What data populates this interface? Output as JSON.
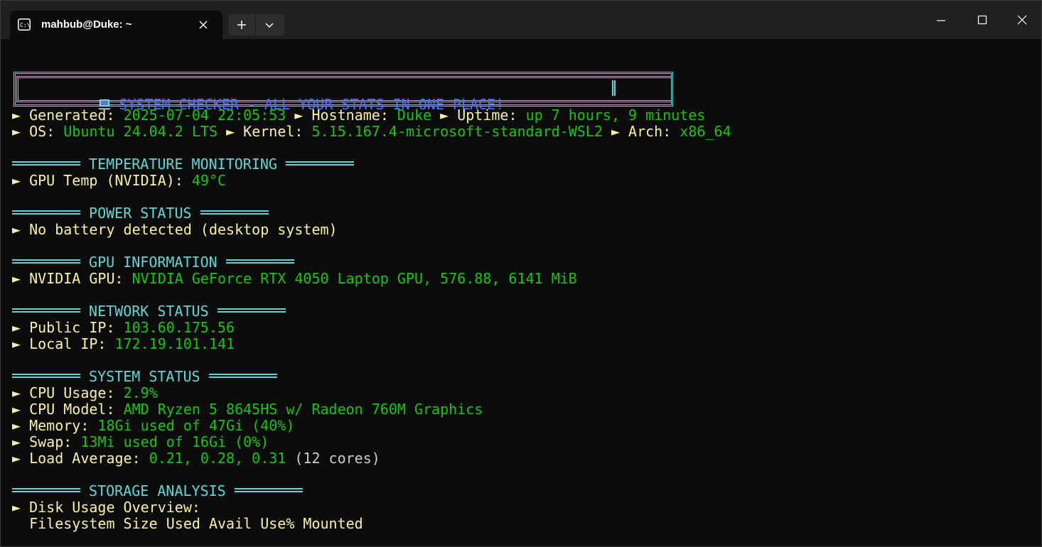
{
  "window": {
    "tab_title": "mahbub@Duke: ~",
    "tab_icon": "terminal-icon",
    "new_tab_icon": "plus-icon",
    "dropdown_icon": "chevron-down-icon",
    "minimize_icon": "minimize-icon",
    "maximize_icon": "maximize-icon",
    "close_icon": "close-icon"
  },
  "colors": {
    "background": "#0c0c0c",
    "titlebar": "#202020",
    "label_yellow": "#f9f1a5",
    "value_green": "#16c60c",
    "header_cyan": "#61d6d6",
    "banner_blue": "#3b78ff"
  },
  "banner": {
    "icon": "laptop-icon",
    "text": "SYSTEM CHECKER - ALL YOUR STATS IN ONE PLACE!"
  },
  "bullet": "►",
  "summary": {
    "generated_label": "Generated:",
    "generated_value": "2025-07-04 22:05:53",
    "hostname_label": "Hostname:",
    "hostname_value": "Duke",
    "uptime_label": "Uptime:",
    "uptime_value": "up 7 hours, 9 minutes",
    "os_label": "OS:",
    "os_value": "Ubuntu 24.04.2 LTS",
    "kernel_label": "Kernel:",
    "kernel_value": "5.15.167.4-microsoft-standard-WSL2",
    "arch_label": "Arch:",
    "arch_value": "x86_64"
  },
  "temperature": {
    "header": "TEMPERATURE MONITORING",
    "gpu_temp_label": "GPU Temp (NVIDIA):",
    "gpu_temp_value": "49°C"
  },
  "power": {
    "header": "POWER STATUS",
    "message": "No battery detected (desktop system)"
  },
  "gpu": {
    "header": "GPU INFORMATION",
    "label": "NVIDIA GPU:",
    "value": "NVIDIA GeForce RTX 4050 Laptop GPU, 576.88, 6141 MiB"
  },
  "network": {
    "header": "NETWORK STATUS",
    "public_ip_label": "Public IP:",
    "public_ip_value": "103.60.175.56",
    "local_ip_label": "Local IP:",
    "local_ip_value": "172.19.101.141"
  },
  "system": {
    "header": "SYSTEM STATUS",
    "cpu_usage_label": "CPU Usage:",
    "cpu_usage_value": "2.9%",
    "cpu_model_label": "CPU Model:",
    "cpu_model_value": "AMD Ryzen 5 8645HS w/ Radeon 760M Graphics",
    "memory_label": "Memory:",
    "memory_value": "18Gi used of 47Gi (40%)",
    "swap_label": "Swap:",
    "swap_value": "13Mi used of 16Gi (0%)",
    "load_label": "Load Average:",
    "load_value": "0.21, 0.28, 0.31",
    "load_cores": "(12 cores)"
  },
  "storage": {
    "header": "STORAGE ANALYSIS",
    "overview_label": "Disk Usage Overview:",
    "table_header": "Filesystem Size Used Avail Use% Mounted"
  }
}
